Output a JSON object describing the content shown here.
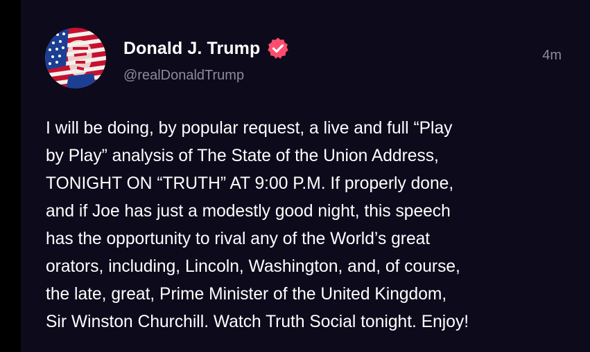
{
  "post": {
    "author": {
      "display_name": "Donald J. Trump",
      "handle": "@realDonaldTrump",
      "verified_icon": "verified-badge-icon",
      "avatar_icon": "avatar-flag-portrait"
    },
    "timestamp": "4m",
    "body": "I will be doing, by popular request, a live and full “Play\nby Play” analysis of The State of the Union Address,\nTONIGHT ON “TRUTH” AT 9:00 P.M. If properly done,\nand if Joe has just a modestly good night, this speech\nhas the opportunity to rival any of the World’s great\norators, including, Lincoln, Washington, and, of course,\nthe late, great, Prime Minister of the United Kingdom,\nSir Winston Churchill. Watch Truth Social tonight. Enjoy!"
  },
  "colors": {
    "background": "#0d0a1b",
    "text_primary": "#ffffff",
    "text_secondary": "#8e8a9e",
    "verified_badge": "#ff4d6d"
  }
}
